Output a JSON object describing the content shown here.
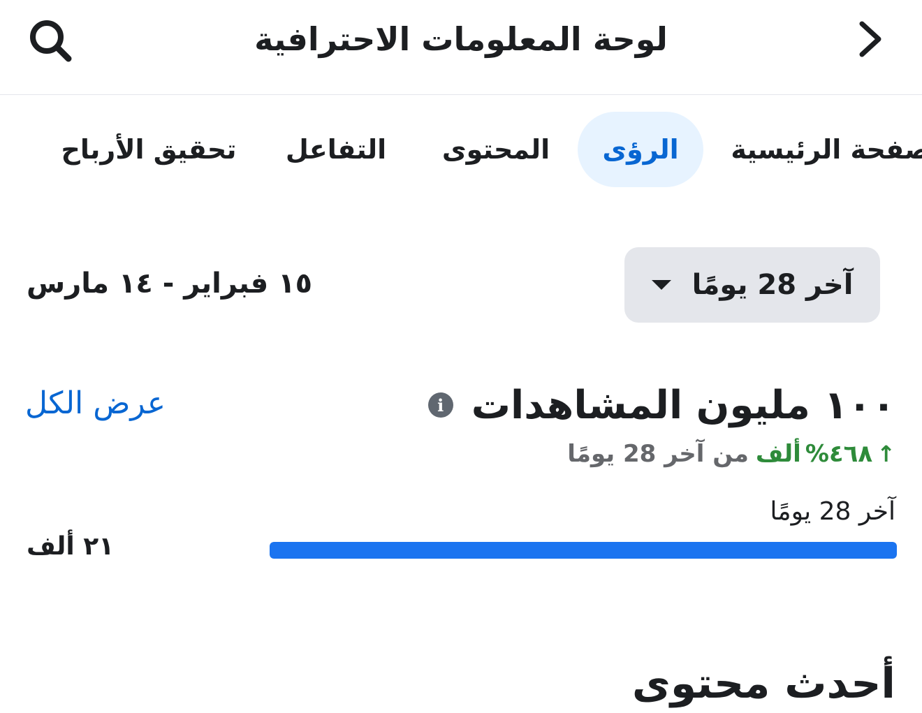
{
  "header": {
    "title": "لوحة المعلومات الاحترافية",
    "back_icon": "chevron-right-icon",
    "search_icon": "search-icon"
  },
  "tabs": [
    {
      "label": "الصفحة الرئيسية",
      "active": false
    },
    {
      "label": "الرؤى",
      "active": true
    },
    {
      "label": "المحتوى",
      "active": false
    },
    {
      "label": "التفاعل",
      "active": false
    },
    {
      "label": "تحقيق الأرباح",
      "active": false
    }
  ],
  "filters": {
    "range_select": "آخر 28 يومًا",
    "date_range": "١٥ فبراير - ١٤ مارس"
  },
  "views": {
    "title": "١٠٠ مليون المشاهدات",
    "see_all": "عرض الكل",
    "change_value": "٤٦٨%",
    "change_unit": "ألف",
    "change_suffix": "من آخر 28 يومًا",
    "period_label": "آخر 28 يومًا",
    "bar_value": "٢١ ألف",
    "bar_fill_fraction": 1.0
  },
  "latest": {
    "heading": "أحدث محتوى"
  },
  "colors": {
    "accent": "#0866d2",
    "bar": "#1b74f0",
    "positive": "#2e8b3a",
    "active_tab_bg": "#e7f3ff"
  }
}
